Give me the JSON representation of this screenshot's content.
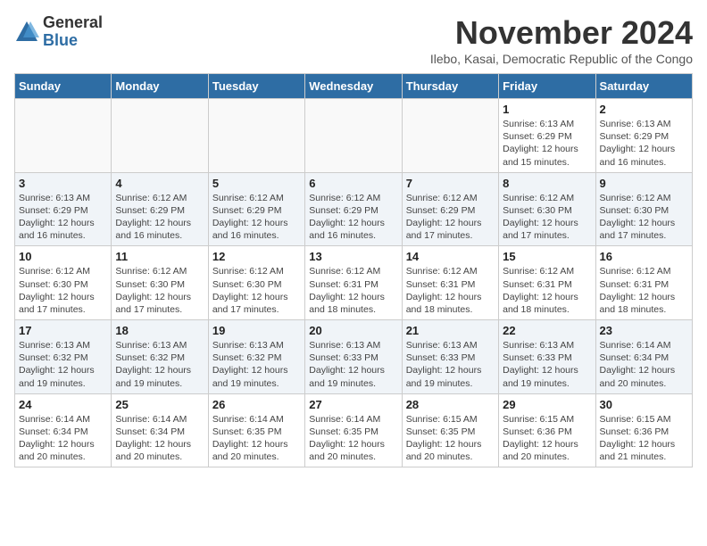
{
  "logo": {
    "general": "General",
    "blue": "Blue"
  },
  "header": {
    "month": "November 2024",
    "subtitle": "Ilebo, Kasai, Democratic Republic of the Congo"
  },
  "weekdays": [
    "Sunday",
    "Monday",
    "Tuesday",
    "Wednesday",
    "Thursday",
    "Friday",
    "Saturday"
  ],
  "weeks": [
    [
      {
        "day": "",
        "info": ""
      },
      {
        "day": "",
        "info": ""
      },
      {
        "day": "",
        "info": ""
      },
      {
        "day": "",
        "info": ""
      },
      {
        "day": "",
        "info": ""
      },
      {
        "day": "1",
        "info": "Sunrise: 6:13 AM\nSunset: 6:29 PM\nDaylight: 12 hours\nand 15 minutes."
      },
      {
        "day": "2",
        "info": "Sunrise: 6:13 AM\nSunset: 6:29 PM\nDaylight: 12 hours\nand 16 minutes."
      }
    ],
    [
      {
        "day": "3",
        "info": "Sunrise: 6:13 AM\nSunset: 6:29 PM\nDaylight: 12 hours\nand 16 minutes."
      },
      {
        "day": "4",
        "info": "Sunrise: 6:12 AM\nSunset: 6:29 PM\nDaylight: 12 hours\nand 16 minutes."
      },
      {
        "day": "5",
        "info": "Sunrise: 6:12 AM\nSunset: 6:29 PM\nDaylight: 12 hours\nand 16 minutes."
      },
      {
        "day": "6",
        "info": "Sunrise: 6:12 AM\nSunset: 6:29 PM\nDaylight: 12 hours\nand 16 minutes."
      },
      {
        "day": "7",
        "info": "Sunrise: 6:12 AM\nSunset: 6:29 PM\nDaylight: 12 hours\nand 17 minutes."
      },
      {
        "day": "8",
        "info": "Sunrise: 6:12 AM\nSunset: 6:30 PM\nDaylight: 12 hours\nand 17 minutes."
      },
      {
        "day": "9",
        "info": "Sunrise: 6:12 AM\nSunset: 6:30 PM\nDaylight: 12 hours\nand 17 minutes."
      }
    ],
    [
      {
        "day": "10",
        "info": "Sunrise: 6:12 AM\nSunset: 6:30 PM\nDaylight: 12 hours\nand 17 minutes."
      },
      {
        "day": "11",
        "info": "Sunrise: 6:12 AM\nSunset: 6:30 PM\nDaylight: 12 hours\nand 17 minutes."
      },
      {
        "day": "12",
        "info": "Sunrise: 6:12 AM\nSunset: 6:30 PM\nDaylight: 12 hours\nand 17 minutes."
      },
      {
        "day": "13",
        "info": "Sunrise: 6:12 AM\nSunset: 6:31 PM\nDaylight: 12 hours\nand 18 minutes."
      },
      {
        "day": "14",
        "info": "Sunrise: 6:12 AM\nSunset: 6:31 PM\nDaylight: 12 hours\nand 18 minutes."
      },
      {
        "day": "15",
        "info": "Sunrise: 6:12 AM\nSunset: 6:31 PM\nDaylight: 12 hours\nand 18 minutes."
      },
      {
        "day": "16",
        "info": "Sunrise: 6:12 AM\nSunset: 6:31 PM\nDaylight: 12 hours\nand 18 minutes."
      }
    ],
    [
      {
        "day": "17",
        "info": "Sunrise: 6:13 AM\nSunset: 6:32 PM\nDaylight: 12 hours\nand 19 minutes."
      },
      {
        "day": "18",
        "info": "Sunrise: 6:13 AM\nSunset: 6:32 PM\nDaylight: 12 hours\nand 19 minutes."
      },
      {
        "day": "19",
        "info": "Sunrise: 6:13 AM\nSunset: 6:32 PM\nDaylight: 12 hours\nand 19 minutes."
      },
      {
        "day": "20",
        "info": "Sunrise: 6:13 AM\nSunset: 6:33 PM\nDaylight: 12 hours\nand 19 minutes."
      },
      {
        "day": "21",
        "info": "Sunrise: 6:13 AM\nSunset: 6:33 PM\nDaylight: 12 hours\nand 19 minutes."
      },
      {
        "day": "22",
        "info": "Sunrise: 6:13 AM\nSunset: 6:33 PM\nDaylight: 12 hours\nand 19 minutes."
      },
      {
        "day": "23",
        "info": "Sunrise: 6:14 AM\nSunset: 6:34 PM\nDaylight: 12 hours\nand 20 minutes."
      }
    ],
    [
      {
        "day": "24",
        "info": "Sunrise: 6:14 AM\nSunset: 6:34 PM\nDaylight: 12 hours\nand 20 minutes."
      },
      {
        "day": "25",
        "info": "Sunrise: 6:14 AM\nSunset: 6:34 PM\nDaylight: 12 hours\nand 20 minutes."
      },
      {
        "day": "26",
        "info": "Sunrise: 6:14 AM\nSunset: 6:35 PM\nDaylight: 12 hours\nand 20 minutes."
      },
      {
        "day": "27",
        "info": "Sunrise: 6:14 AM\nSunset: 6:35 PM\nDaylight: 12 hours\nand 20 minutes."
      },
      {
        "day": "28",
        "info": "Sunrise: 6:15 AM\nSunset: 6:35 PM\nDaylight: 12 hours\nand 20 minutes."
      },
      {
        "day": "29",
        "info": "Sunrise: 6:15 AM\nSunset: 6:36 PM\nDaylight: 12 hours\nand 20 minutes."
      },
      {
        "day": "30",
        "info": "Sunrise: 6:15 AM\nSunset: 6:36 PM\nDaylight: 12 hours\nand 21 minutes."
      }
    ]
  ]
}
